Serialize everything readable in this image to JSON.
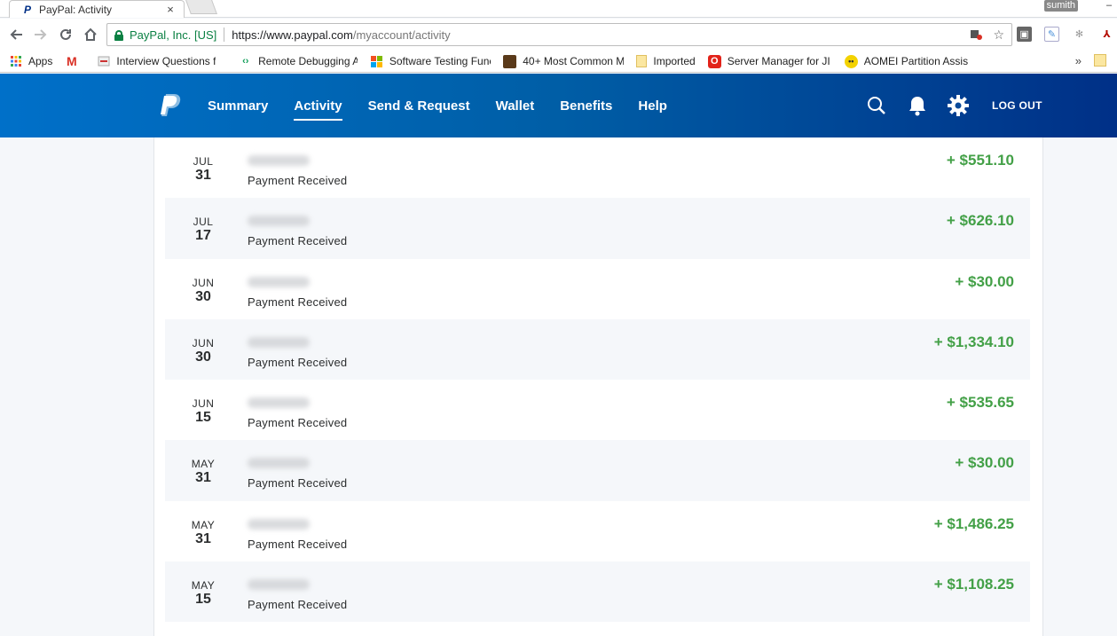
{
  "browser": {
    "tab_title": "PayPal: Activity",
    "tab_close": "×",
    "profile": "sumith",
    "ev_name": "PayPal, Inc. [US]",
    "url_host": "https://www.paypal.com",
    "url_path": "/myaccount/activity"
  },
  "bookmarks": [
    {
      "label": "Apps",
      "icon": "apps-grid-icon",
      "color": "#e94235"
    },
    {
      "label": "",
      "icon": "gmail-icon",
      "color": "#d93025"
    },
    {
      "label": "Interview Questions f",
      "icon": "page-icon",
      "color": "#888888"
    },
    {
      "label": "Remote Debugging A",
      "icon": "devtools-icon",
      "color": "#0f9d58"
    },
    {
      "label": "Software Testing Func",
      "icon": "windows-icon",
      "color": "#f25022"
    },
    {
      "label": "40+ Most Common M",
      "icon": "site-icon",
      "color": "#5a3a1a"
    },
    {
      "label": "Imported",
      "icon": "folder-icon",
      "color": "#f6d26b"
    },
    {
      "label": "Server Manager for JI",
      "icon": "oracle-icon",
      "color": "#e2231a"
    },
    {
      "label": "AOMEI Partition Assis",
      "icon": "aomei-icon",
      "color": "#f3d200"
    }
  ],
  "bookmarks_more": "»",
  "paypal": {
    "nav": [
      {
        "label": "Summary",
        "active": false
      },
      {
        "label": "Activity",
        "active": true
      },
      {
        "label": "Send & Request",
        "active": false
      },
      {
        "label": "Wallet",
        "active": false
      },
      {
        "label": "Benefits",
        "active": false
      },
      {
        "label": "Help",
        "active": false
      }
    ],
    "logout": "LOG OUT"
  },
  "transactions": [
    {
      "month": "JUL",
      "day": "31",
      "description": "Payment Received",
      "amount": "+ $551.10"
    },
    {
      "month": "JUL",
      "day": "17",
      "description": "Payment Received",
      "amount": "+ $626.10"
    },
    {
      "month": "JUN",
      "day": "30",
      "description": "Payment Received",
      "amount": "+ $30.00"
    },
    {
      "month": "JUN",
      "day": "30",
      "description": "Payment Received",
      "amount": "+ $1,334.10"
    },
    {
      "month": "JUN",
      "day": "15",
      "description": "Payment Received",
      "amount": "+ $535.65"
    },
    {
      "month": "MAY",
      "day": "31",
      "description": "Payment Received",
      "amount": "+ $30.00"
    },
    {
      "month": "MAY",
      "day": "31",
      "description": "Payment Received",
      "amount": "+ $1,486.25"
    },
    {
      "month": "MAY",
      "day": "15",
      "description": "Payment Received",
      "amount": "+ $1,108.25"
    }
  ],
  "colors": {
    "brand_blue": "#003087",
    "header_light": "#0070c9",
    "amount_green": "#43a047",
    "row_alt": "#f5f7fa"
  }
}
